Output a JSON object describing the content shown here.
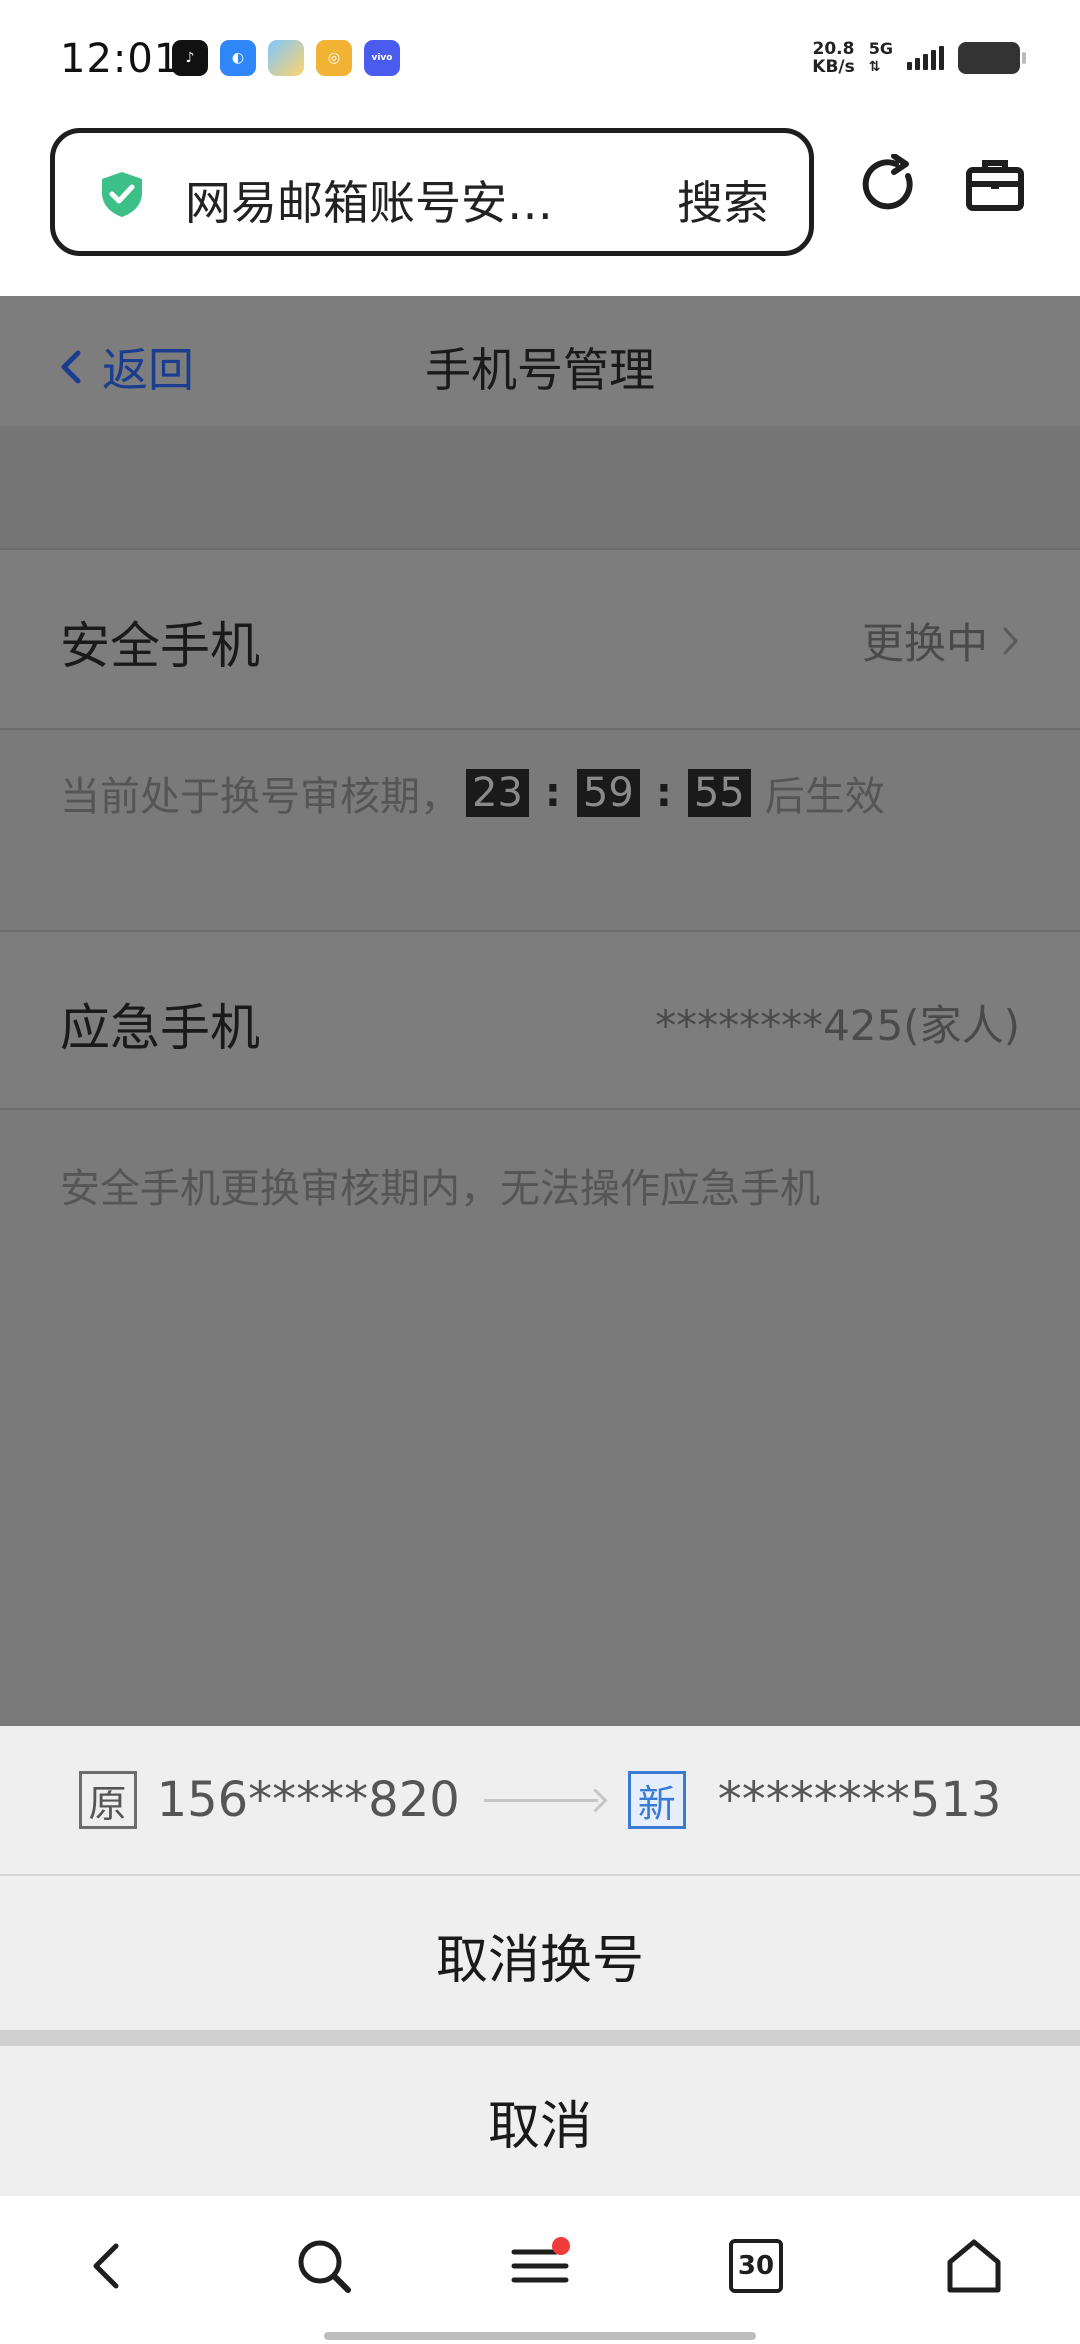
{
  "status_bar": {
    "time": "12:01",
    "net_speed_value": "20.8",
    "net_speed_unit": "KB/s",
    "network": "5G",
    "apps": [
      "tiktok-icon",
      "browser-icon",
      "weather-icon",
      "music-icon",
      "vivo-icon"
    ],
    "vivo_label": "vivo"
  },
  "browser": {
    "address_text": "网易邮箱账号安…",
    "search_label": "搜索",
    "tab_count": "30"
  },
  "page": {
    "back_label": "返回",
    "title": "手机号管理",
    "security_phone_label": "安全手机",
    "security_phone_status": "更换中",
    "review_hint_prefix": "当前处于换号审核期，",
    "countdown": {
      "hours": "23",
      "minutes": "59",
      "seconds": "55"
    },
    "review_hint_suffix": "后生效",
    "emergency_phone_label": "应急手机",
    "emergency_phone_value": "********425(家人)",
    "emergency_hint": "安全手机更换审核期内，无法操作应急手机"
  },
  "sheet": {
    "old_tag": "原",
    "old_number": "156*****820",
    "new_tag": "新",
    "new_number": "********513",
    "cancel_change_label": "取消换号",
    "cancel_label": "取消"
  },
  "colors": {
    "overlay_gray": "#7a7a7a",
    "link_blue": "#1b3d8f",
    "new_tag_blue": "#3a7bd5",
    "shield_green": "#3dbf88",
    "notification_red": "#f23b3b"
  }
}
